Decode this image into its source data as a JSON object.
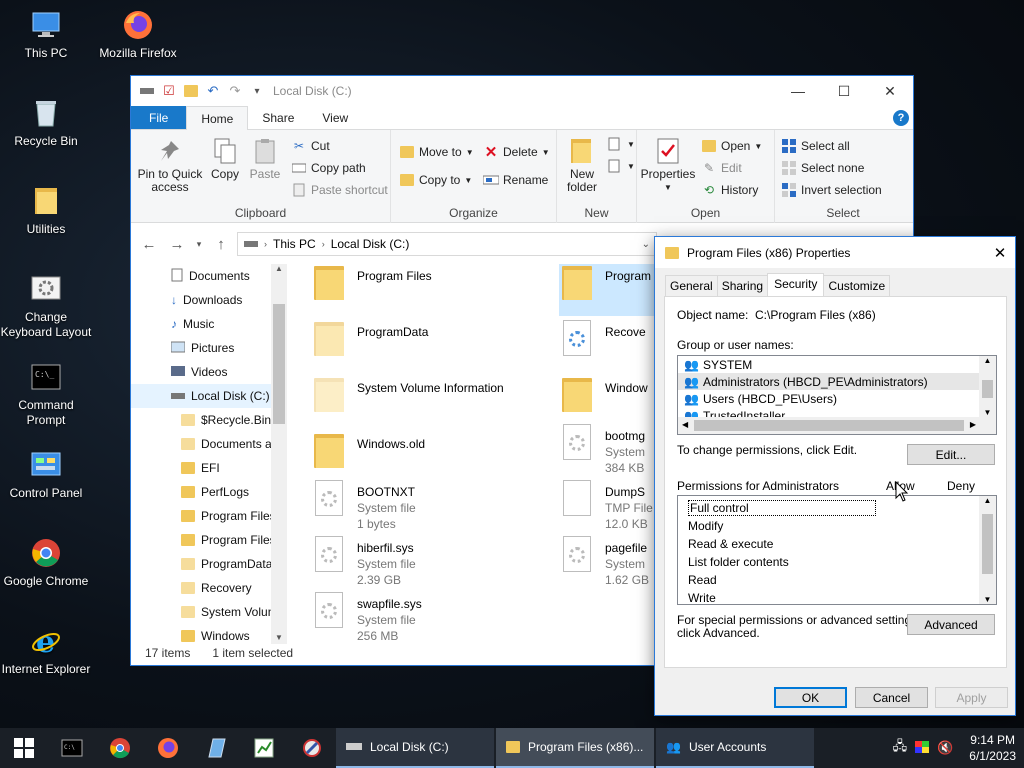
{
  "desktop": {
    "icons": [
      {
        "label": "This PC"
      },
      {
        "label": "Mozilla Firefox"
      },
      {
        "label": "Recycle Bin"
      },
      {
        "label": "Utilities"
      },
      {
        "label": "Change Keyboard Layout"
      },
      {
        "label": "Command Prompt"
      },
      {
        "label": "Control Panel"
      },
      {
        "label": "Google Chrome"
      },
      {
        "label": "Internet Explorer"
      }
    ]
  },
  "explorer": {
    "title": "Local Disk (C:)",
    "tabs": {
      "file": "File",
      "home": "Home",
      "share": "Share",
      "view": "View"
    },
    "help": "?",
    "ribbon": {
      "clipboard": {
        "pin": "Pin to Quick access",
        "copy": "Copy",
        "paste": "Paste",
        "cut": "Cut",
        "copy_path": "Copy path",
        "paste_shortcut": "Paste shortcut",
        "label": "Clipboard"
      },
      "organize": {
        "move_to": "Move to",
        "copy_to": "Copy to",
        "delete": "Delete",
        "rename": "Rename",
        "label": "Organize"
      },
      "new": {
        "new_folder": "New folder",
        "label": "New"
      },
      "open": {
        "properties": "Properties",
        "open": "Open",
        "edit": "Edit",
        "history": "History",
        "label": "Open"
      },
      "select": {
        "select_all": "Select all",
        "select_none": "Select none",
        "invert": "Invert selection",
        "label": "Select"
      }
    },
    "address": {
      "crumb1": "This PC",
      "crumb2": "Local Disk (C:)"
    },
    "nav_items": [
      {
        "label": "Documents"
      },
      {
        "label": "Downloads"
      },
      {
        "label": "Music"
      },
      {
        "label": "Pictures"
      },
      {
        "label": "Videos"
      },
      {
        "label": "Local Disk (C:)"
      },
      {
        "label": "$Recycle.Bin"
      },
      {
        "label": "Documents a"
      },
      {
        "label": "EFI"
      },
      {
        "label": "PerfLogs"
      },
      {
        "label": "Program Files"
      },
      {
        "label": "Program Files"
      },
      {
        "label": "ProgramData"
      },
      {
        "label": "Recovery"
      },
      {
        "label": "System Volun"
      },
      {
        "label": "Windows"
      }
    ],
    "files": [
      {
        "name": "Program Files",
        "type": "",
        "size": ""
      },
      {
        "name": "ProgramData",
        "type": "",
        "size": ""
      },
      {
        "name": "System Volume Information",
        "type": "",
        "size": ""
      },
      {
        "name": "Windows.old",
        "type": "",
        "size": ""
      },
      {
        "name": "BOOTNXT",
        "type": "System file",
        "size": "1 bytes"
      },
      {
        "name": "hiberfil.sys",
        "type": "System file",
        "size": "2.39 GB"
      },
      {
        "name": "swapfile.sys",
        "type": "System file",
        "size": "256 MB"
      },
      {
        "name": "Program",
        "type": "",
        "size": ""
      },
      {
        "name": "Recove",
        "type": "",
        "size": ""
      },
      {
        "name": "Window",
        "type": "",
        "size": ""
      },
      {
        "name": "bootmg",
        "type": "System",
        "size": "384 KB"
      },
      {
        "name": "DumpS",
        "type": "TMP File",
        "size": "12.0 KB"
      },
      {
        "name": "pagefile",
        "type": "System",
        "size": "1.62 GB"
      }
    ],
    "status": {
      "count": "17 items",
      "selected": "1 item selected"
    }
  },
  "properties": {
    "title": "Program Files (x86) Properties",
    "tabs": [
      "General",
      "Sharing",
      "Security",
      "Customize"
    ],
    "object_label": "Object name:",
    "object_value": "C:\\Program Files (x86)",
    "group_label": "Group or user names:",
    "users": [
      "SYSTEM",
      "Administrators (HBCD_PE\\Administrators)",
      "Users (HBCD_PE\\Users)",
      "TrustedInstaller"
    ],
    "change_text": "To change permissions, click Edit.",
    "edit_button": "Edit...",
    "perm_label": "Permissions for Administrators",
    "allow": "Allow",
    "deny": "Deny",
    "permissions": [
      "Full control",
      "Modify",
      "Read & execute",
      "List folder contents",
      "Read",
      "Write"
    ],
    "special_text_1": "For special permissions or advanced settings,",
    "special_text_2": "click Advanced.",
    "advanced_button": "Advanced",
    "ok": "OK",
    "cancel": "Cancel",
    "apply": "Apply"
  },
  "taskbar": {
    "tasks": [
      "Local Disk (C:)",
      "Program Files (x86)...",
      "User Accounts"
    ],
    "time": "9:14 PM",
    "date": "6/1/2023"
  }
}
